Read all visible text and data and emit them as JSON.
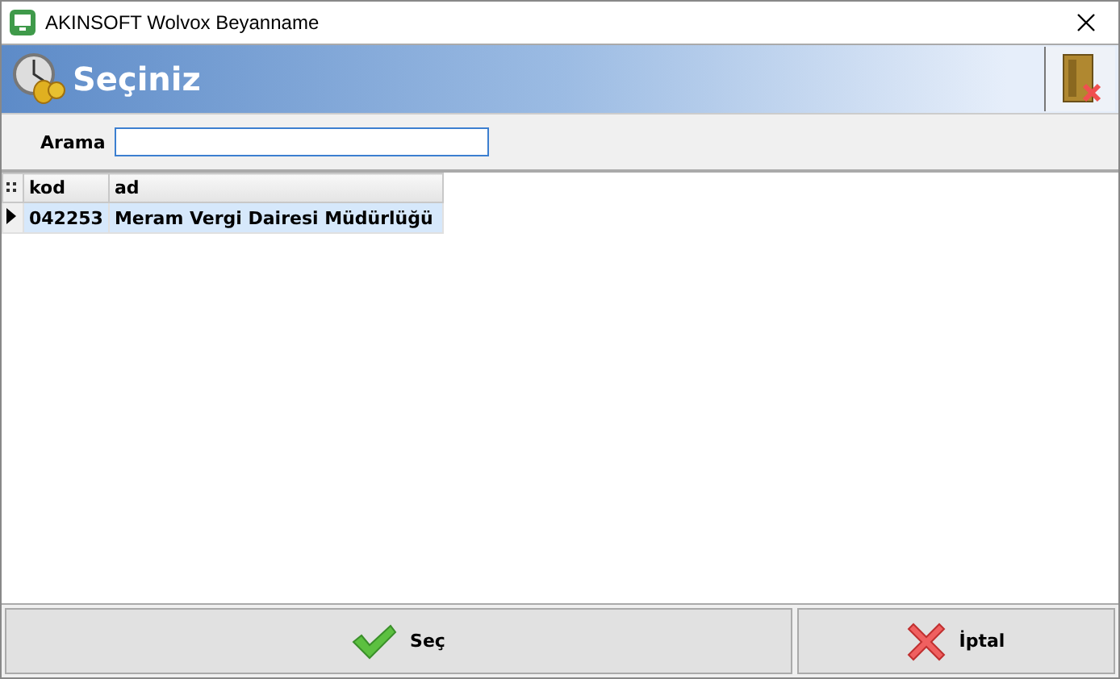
{
  "window": {
    "title": "AKINSOFT Wolvox Beyanname"
  },
  "header": {
    "title": "Seçiniz"
  },
  "search": {
    "label": "Arama"
  },
  "table": {
    "columns": [
      "kod",
      "ad"
    ],
    "rows": [
      {
        "cells": [
          "042253",
          "Meram Vergi Dairesi Müdürlüğü"
        ],
        "selected": true
      }
    ]
  },
  "buttons": [
    {
      "kind": "ok",
      "label": "Seç"
    },
    {
      "kind": "cancel",
      "label": "İptal"
    }
  ]
}
